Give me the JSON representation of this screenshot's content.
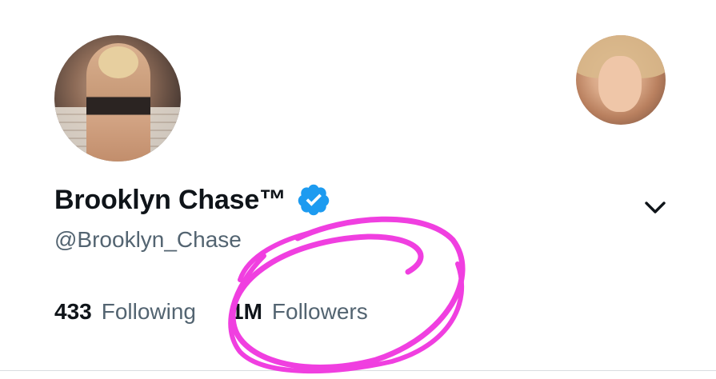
{
  "profile": {
    "display_name": "Brooklyn Chase™",
    "handle": "@Brooklyn_Chase",
    "verified": true
  },
  "stats": {
    "following_count": "433",
    "following_label": "Following",
    "followers_count": "1M",
    "followers_label": "Followers"
  },
  "icons": {
    "verified": "verified-badge-icon",
    "more": "chevron-down-icon"
  },
  "colors": {
    "verified_blue": "#1d9bf0",
    "annotation_magenta": "#f03fe0",
    "text_primary": "#0f1419",
    "text_secondary": "#536471"
  }
}
